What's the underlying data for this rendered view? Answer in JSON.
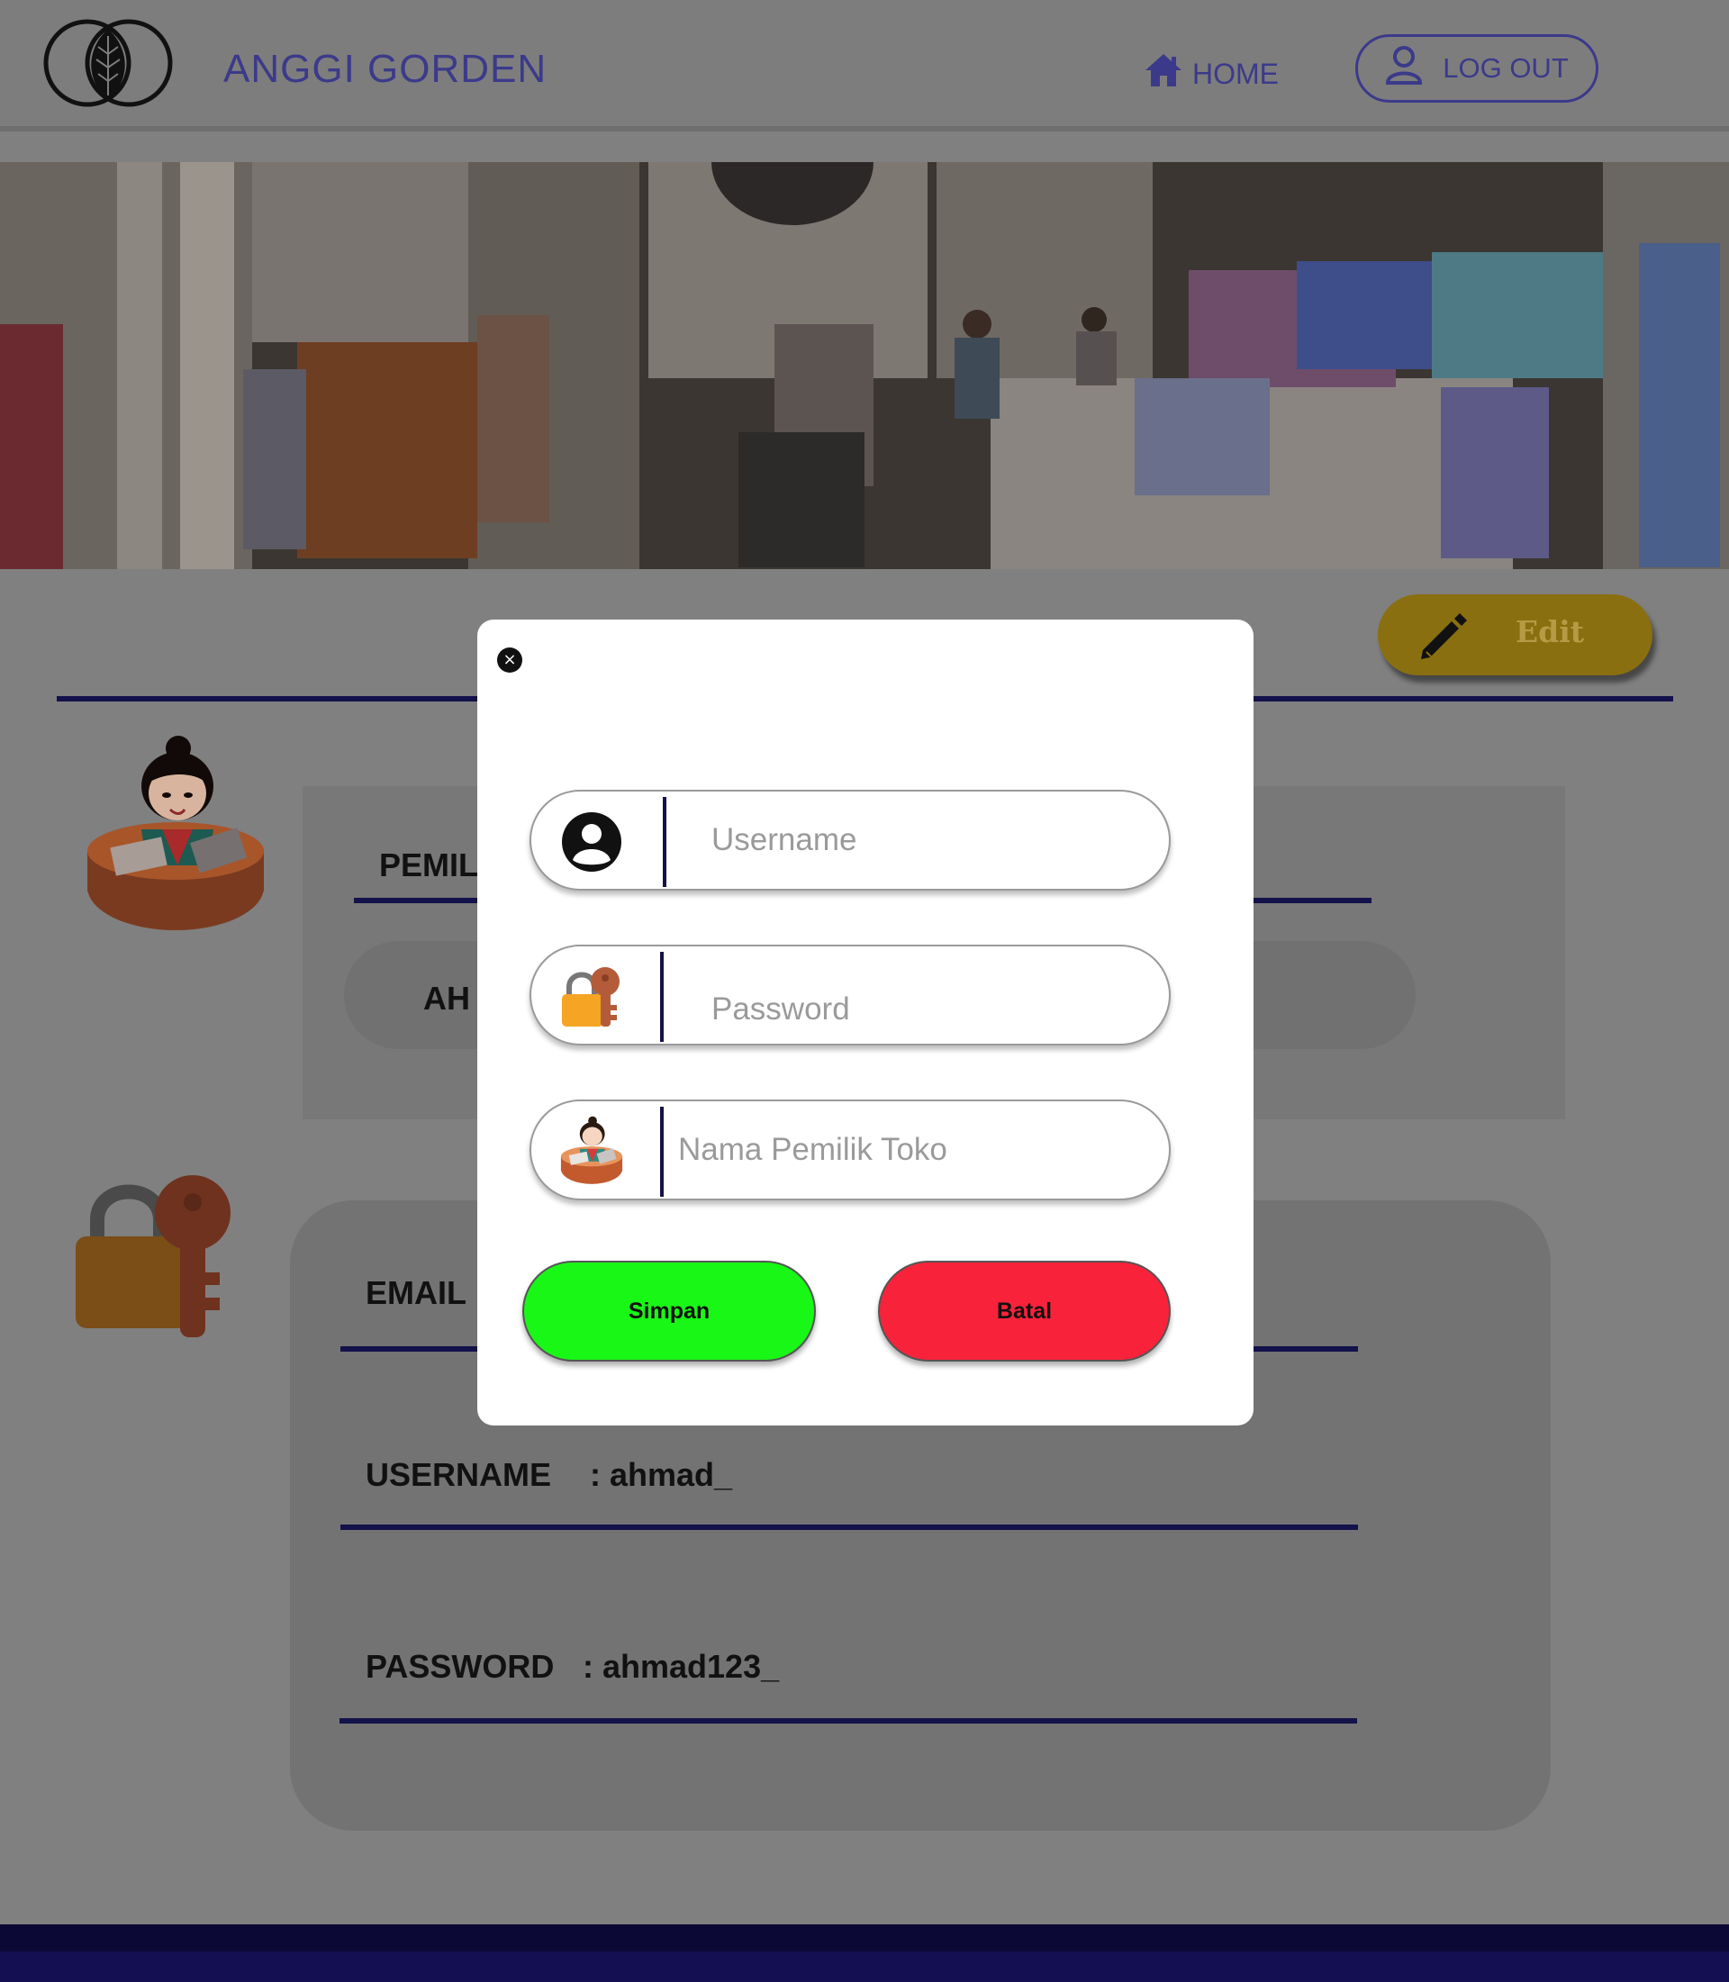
{
  "header": {
    "brand": "ANGGI GORDEN",
    "home_label": "HOME",
    "logout_label": "LOG OUT",
    "icons": {
      "logo": "leaf-logo-icon",
      "home": "home-icon",
      "logout": "user-icon"
    }
  },
  "profile": {
    "edit_label": "Edit",
    "owner_label": "PEMIL",
    "owner_value": "AH",
    "email_label": "EMAIL",
    "username_label": "USERNAME",
    "username_value": ": ahmad_",
    "password_label": "PASSWORD",
    "password_value": ": ahmad123_"
  },
  "modal": {
    "close_label": "×",
    "username_placeholder": "Username",
    "password_placeholder": "Password",
    "owner_placeholder": "Nama Pemilik Toko",
    "save_label": "Simpan",
    "cancel_label": "Batal"
  },
  "colors": {
    "accent": "#3b3a8a",
    "rule": "#14124a",
    "save": "#19f716",
    "cancel": "#f9223b",
    "edit": "#8a6f10",
    "overlay": "#808080"
  }
}
